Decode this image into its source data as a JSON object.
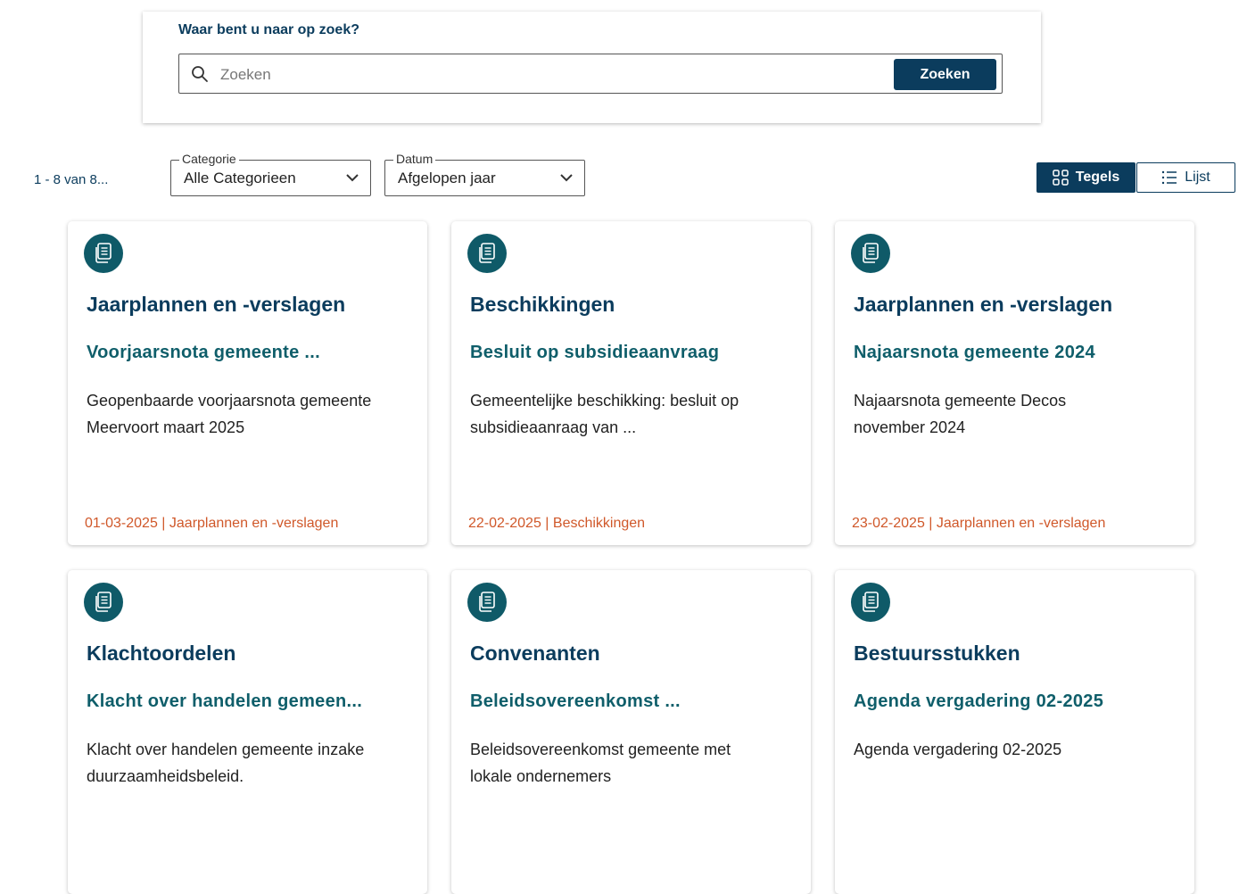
{
  "search": {
    "heading": "Waar bent u naar op zoek?",
    "placeholder": "Zoeken",
    "button_label": "Zoeken"
  },
  "results": {
    "count_text": "1 - 8 van 8..."
  },
  "filters": [
    {
      "legend": "Categorie",
      "value": "Alle Categorieen"
    },
    {
      "legend": "Datum",
      "value": "Afgelopen jaar"
    }
  ],
  "view": {
    "tiles_label": "Tegels",
    "list_label": "Lijst",
    "active": "Tegels"
  },
  "cards": [
    {
      "icon": "document-icon",
      "category": "Jaarplannen en -verslagen",
      "title": "Voorjaarsnota gemeente ...",
      "description": "Geopenbaarde voorjaarsnota gemeente Meervoort maart 2025",
      "meta": "01-03-2025 | Jaarplannen en -verslagen"
    },
    {
      "icon": "document-icon",
      "category": "Beschikkingen",
      "title": "Besluit op subsidieaanvraag",
      "description": "Gemeentelijke beschikking: besluit op subsidieaanraag van ...",
      "meta": "22-02-2025 | Beschikkingen"
    },
    {
      "icon": "document-icon",
      "category": "Jaarplannen en -verslagen",
      "title": "Najaarsnota gemeente 2024",
      "description": "Najaarsnota gemeente Decos november 2024",
      "meta": "23-02-2025 | Jaarplannen en -verslagen"
    },
    {
      "icon": "document-icon",
      "category": "Klachtoordelen",
      "title": "Klacht over handelen gemeen...",
      "description": "Klacht over handelen gemeente inzake duurzaamheidsbeleid.",
      "meta": ""
    },
    {
      "icon": "document-icon",
      "category": "Convenanten",
      "title": "Beleidsovereenkomst ...",
      "description": "Beleidsovereenkomst gemeente met lokale ondernemers",
      "meta": ""
    },
    {
      "icon": "document-icon",
      "category": "Bestuursstukken",
      "title": "Agenda vergadering 02-2025",
      "description": "Agenda vergadering 02-2025",
      "meta": ""
    }
  ],
  "colors": {
    "primary": "#0b3c5d",
    "teal": "#0f5a68",
    "meta_orange": "#d0582a"
  }
}
